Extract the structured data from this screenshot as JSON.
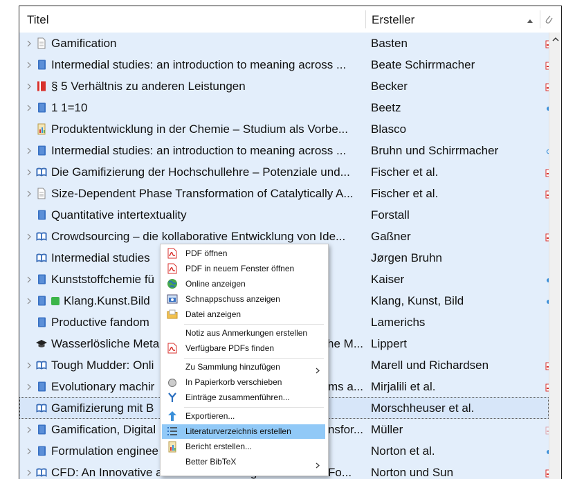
{
  "columns": {
    "title": "Titel",
    "creator": "Ersteller"
  },
  "colors": {
    "row_bg": "#e3eefb",
    "menu_highlight": "#91c9f7",
    "pdf_red": "#d8322d",
    "link_blue": "#3a8fd9",
    "book_blue": "#3b73c4"
  },
  "rows": [
    {
      "title": "Gamification",
      "creator": "Basten",
      "icon": "document-icon",
      "twisty": true,
      "att": "pdf-icon"
    },
    {
      "title": "Intermedial studies: an introduction to meaning across ...",
      "creator": "Beate Schirrmacher",
      "icon": "book-icon",
      "twisty": true,
      "att": "pdf-icon"
    },
    {
      "title": "§ 5 Verhältnis zu anderen Leistungen",
      "creator": "Becker",
      "icon": "law-book-icon",
      "twisty": true,
      "att": "pdf-icon"
    },
    {
      "title": "1 1=10",
      "creator": "Beetz",
      "icon": "book-icon",
      "twisty": true,
      "att": "link-dot-icon"
    },
    {
      "title": "Produktentwicklung in der Chemie – Studium als Vorbe...",
      "creator": "Blasco",
      "icon": "report-icon",
      "twisty": false,
      "att": ""
    },
    {
      "title": "Intermedial studies: an introduction to meaning across ...",
      "creator": "Bruhn und Schirrmacher",
      "icon": "book-icon",
      "twisty": true,
      "att": "link-ring-icon"
    },
    {
      "title": "Die Gamifizierung der Hochschullehre – Potenziale und...",
      "creator": "Fischer et al.",
      "icon": "open-book-icon",
      "twisty": true,
      "att": "pdf-icon"
    },
    {
      "title": "Size-Dependent Phase Transformation of Catalytically A...",
      "creator": "Fischer et al.",
      "icon": "document-icon",
      "twisty": true,
      "att": "pdf-icon"
    },
    {
      "title": "Quantitative intertextuality",
      "creator": "Forstall",
      "icon": "book-icon",
      "twisty": false,
      "att": ""
    },
    {
      "title": "Crowdsourcing – die kollaborative Entwicklung von Ide...",
      "creator": "Gaßner",
      "icon": "open-book-icon",
      "twisty": true,
      "att": "pdf-icon"
    },
    {
      "title": "Intermedial studies",
      "creator": "Jørgen Bruhn",
      "icon": "open-book-icon",
      "twisty": false,
      "att": ""
    },
    {
      "title": "Kunststoffchemie fü",
      "creator": "Kaiser",
      "icon": "book-icon",
      "twisty": true,
      "att": "link-dot-icon"
    },
    {
      "title": "Klang.Kunst.Bild",
      "creator": "Klang, Kunst, Bild",
      "icon": "book-icon",
      "twisty": true,
      "att": "link-dot-icon",
      "tag": true
    },
    {
      "title": "Productive fandom",
      "creator": "Lamerichs",
      "icon": "book-icon",
      "twisty": false,
      "att": ""
    },
    {
      "title": "Wasserlösliche Meta",
      "title_tail": "he M...",
      "creator": "Lippert",
      "icon": "thesis-icon",
      "twisty": false,
      "att": ""
    },
    {
      "title": "Tough Mudder: Onli",
      "creator": "Marell und Richardsen",
      "icon": "open-book-icon",
      "twisty": true,
      "att": "pdf-icon"
    },
    {
      "title": "Evolutionary machir",
      "title_tail": "ams a...",
      "creator": "Mirjalili et al.",
      "icon": "book-icon",
      "twisty": true,
      "att": "pdf-icon"
    },
    {
      "title": "Gamifizierung mit B",
      "creator": "Morschheuser et al.",
      "icon": "open-book-icon",
      "twisty": false,
      "att": "",
      "selected": true
    },
    {
      "title": "Gamification, Digital",
      "title_tail": "nsfor...",
      "creator": "Müller",
      "icon": "book-icon",
      "twisty": true,
      "att": "pdf-faded-icon"
    },
    {
      "title": "Formulation enginee",
      "creator": "Norton et al.",
      "icon": "book-icon",
      "twisty": true,
      "att": "link-dot-icon"
    },
    {
      "title": "CFD: An Innovative and Effective Design Tool for the Fo...",
      "creator": "Norton und Sun",
      "icon": "open-book-icon",
      "twisty": true,
      "att": "pdf-icon"
    }
  ],
  "menu": [
    {
      "label": "PDF öffnen",
      "icon": "pdf-icon",
      "name": "menu-open-pdf"
    },
    {
      "label": "PDF in neuem Fenster öffnen",
      "icon": "pdf-icon",
      "name": "menu-open-pdf-new-window"
    },
    {
      "label": "Online anzeigen",
      "icon": "globe-icon",
      "name": "menu-view-online"
    },
    {
      "label": "Schnappschuss anzeigen",
      "icon": "snapshot-icon",
      "name": "menu-view-snapshot"
    },
    {
      "label": "Datei anzeigen",
      "icon": "folder-icon",
      "name": "menu-show-file",
      "sep_after": true
    },
    {
      "label": "Notiz aus Anmerkungen erstellen",
      "icon": "",
      "name": "menu-note-from-annotations"
    },
    {
      "label": "Verfügbare PDFs finden",
      "icon": "pdf-icon",
      "name": "menu-find-pdfs",
      "sep_after": true
    },
    {
      "label": "Zu Sammlung hinzufügen",
      "icon": "",
      "name": "menu-add-to-collection",
      "submenu": true
    },
    {
      "label": "In Papierkorb verschieben",
      "icon": "trash-icon",
      "name": "menu-move-to-trash"
    },
    {
      "label": "Einträge zusammenführen...",
      "icon": "merge-icon",
      "name": "menu-merge-items",
      "sep_after": true
    },
    {
      "label": "Exportieren...",
      "icon": "export-icon",
      "name": "menu-export"
    },
    {
      "label": "Literaturverzeichnis erstellen",
      "icon": "list-icon",
      "name": "menu-create-bibliography",
      "highlight": true
    },
    {
      "label": "Bericht erstellen...",
      "icon": "report-icon",
      "name": "menu-create-report"
    },
    {
      "label": "Better BibTeX",
      "icon": "",
      "name": "menu-better-bibtex",
      "submenu": true
    }
  ]
}
